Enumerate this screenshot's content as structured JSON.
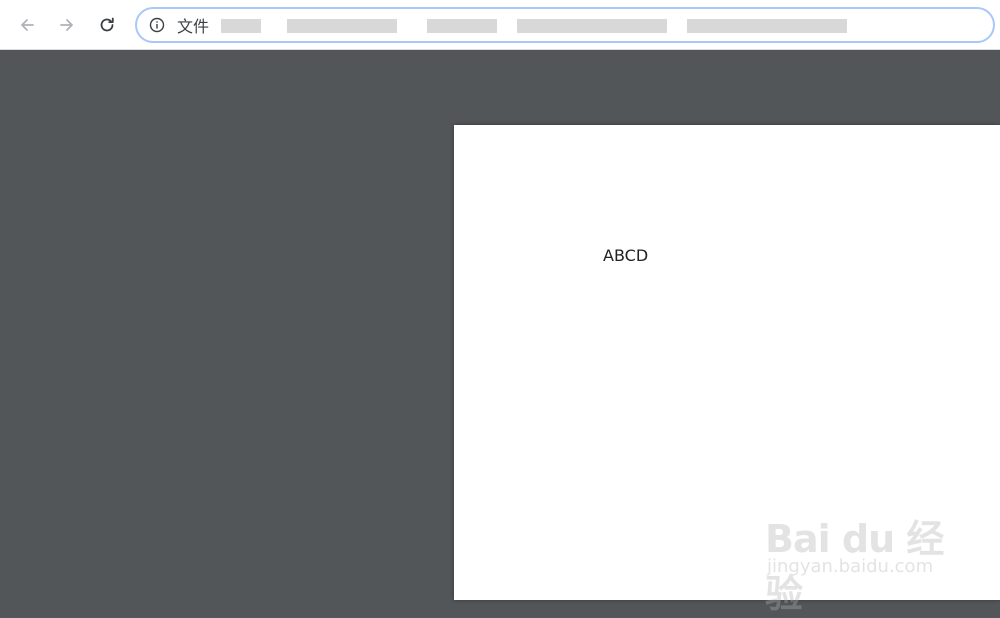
{
  "browser": {
    "back_icon": "arrow-left-icon",
    "forward_icon": "arrow-right-icon",
    "reload_icon": "reload-icon",
    "info_icon": "info-icon",
    "address_scheme_label": "文件",
    "address_url": ""
  },
  "document": {
    "text": "ABCD"
  },
  "watermark": {
    "logo": "Bai du 经验",
    "sub": "jingyan.baidu.com"
  },
  "colors": {
    "viewer_background": "#525659",
    "page_background": "#ffffff",
    "omnibox_border": "#a8c7fa"
  }
}
